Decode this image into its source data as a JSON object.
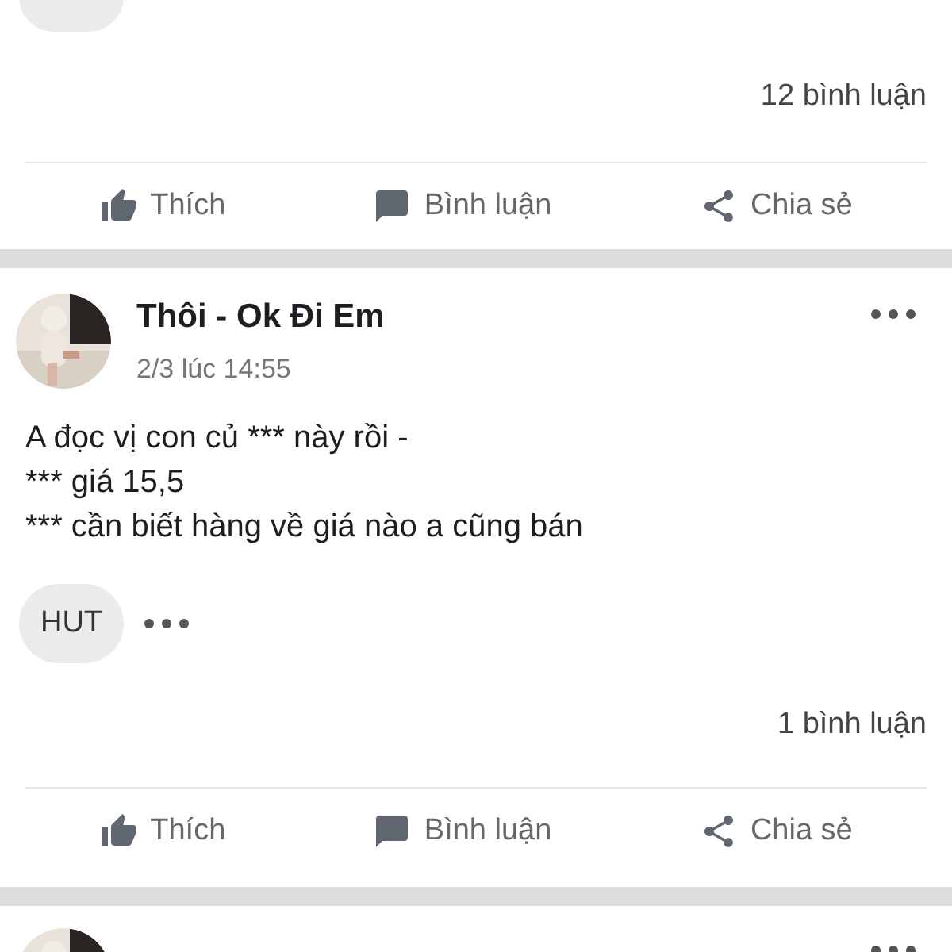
{
  "top_post": {
    "comment_count": "12 bình luận",
    "actions": [
      {
        "kind": "like",
        "label": "Thích"
      },
      {
        "kind": "comment",
        "label": "Bình luận"
      },
      {
        "kind": "share",
        "label": "Chia sẻ"
      }
    ]
  },
  "post": {
    "author": "Thôi - Ok Đi Em",
    "time": "2/3 lúc 14:55",
    "body_lines": [
      "A đọc vị con củ *** này rồi -",
      "*** giá 15,5",
      "*** cần biết hàng về giá nào a cũng bán"
    ],
    "chip": "HUT",
    "comment_count": "1 bình luận",
    "actions": [
      {
        "kind": "like",
        "label": "Thích"
      },
      {
        "kind": "comment",
        "label": "Bình luận"
      },
      {
        "kind": "share",
        "label": "Chia sẻ"
      }
    ]
  }
}
